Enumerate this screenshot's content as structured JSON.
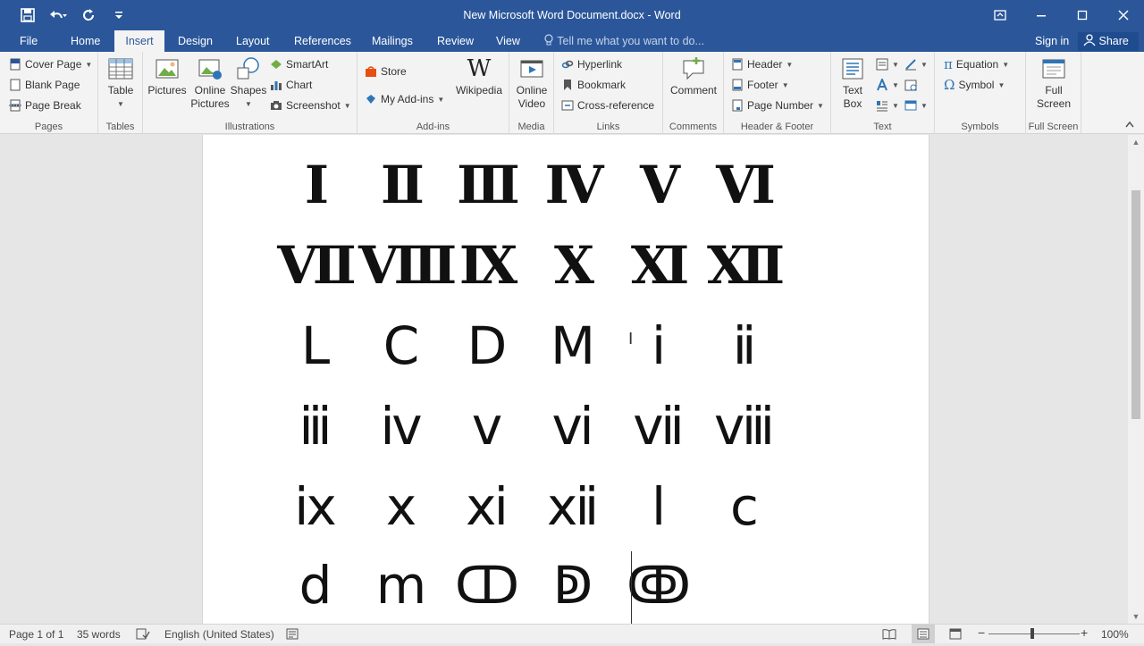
{
  "titlebar": {
    "title": "New Microsoft Word Document.docx - Word",
    "qat": {
      "save_icon": "save-icon",
      "undo_icon": "undo-icon",
      "redo_icon": "redo-icon",
      "customize_icon": "customize-icon"
    },
    "window": {
      "ribbon_options_icon": "ribbon-display-icon",
      "minimize_icon": "minimize-icon",
      "maximize_icon": "maximize-icon",
      "close_icon": "close-icon"
    }
  },
  "tabs": [
    {
      "label": "File"
    },
    {
      "label": "Home"
    },
    {
      "label": "Insert"
    },
    {
      "label": "Design"
    },
    {
      "label": "Layout"
    },
    {
      "label": "References"
    },
    {
      "label": "Mailings"
    },
    {
      "label": "Review"
    },
    {
      "label": "View"
    }
  ],
  "tell_me": "Tell me what you want to do...",
  "sign_in": "Sign in",
  "share": "Share",
  "ribbon": {
    "pages": {
      "label": "Pages",
      "cover_page": "Cover Page",
      "blank_page": "Blank Page",
      "page_break": "Page Break"
    },
    "tables": {
      "label": "Tables",
      "table": "Table"
    },
    "illustrations": {
      "label": "Illustrations",
      "pictures": "Pictures",
      "online_pictures_1": "Online",
      "online_pictures_2": "Pictures",
      "shapes": "Shapes",
      "smartart": "SmartArt",
      "chart": "Chart",
      "screenshot": "Screenshot"
    },
    "addins": {
      "label": "Add-ins",
      "store": "Store",
      "my_addins": "My Add-ins",
      "wikipedia": "Wikipedia"
    },
    "media": {
      "label": "Media",
      "online_video_1": "Online",
      "online_video_2": "Video"
    },
    "links": {
      "label": "Links",
      "hyperlink": "Hyperlink",
      "bookmark": "Bookmark",
      "cross_reference": "Cross-reference"
    },
    "comments": {
      "label": "Comments",
      "comment": "Comment"
    },
    "header_footer": {
      "label": "Header & Footer",
      "header": "Header",
      "footer": "Footer",
      "page_number": "Page Number"
    },
    "text": {
      "label": "Text",
      "text_box_1": "Text",
      "text_box_2": "Box"
    },
    "symbols": {
      "label": "Symbols",
      "equation": "Equation",
      "symbol": "Symbol"
    },
    "full_screen": {
      "label": "Full Screen",
      "full_1": "Full",
      "full_2": "Screen"
    }
  },
  "document": {
    "rows": [
      [
        "Ⅰ",
        "Ⅱ",
        "Ⅲ",
        "Ⅳ",
        "Ⅴ",
        "Ⅵ"
      ],
      [
        "Ⅶ",
        "Ⅷ",
        "Ⅸ",
        "Ⅹ",
        "Ⅺ",
        "Ⅻ"
      ],
      [
        "Ⅼ",
        "Ⅽ",
        "Ⅾ",
        "Ⅿ",
        "ⅰ",
        "ⅱ"
      ],
      [
        "ⅲ",
        "ⅳ",
        "ⅴ",
        "ⅵ",
        "ⅶ",
        "ⅷ"
      ],
      [
        "ⅸ",
        "ⅹ",
        "ⅺ",
        "ⅻ",
        "ⅼ",
        "ⅽ"
      ],
      [
        "ⅾ",
        "ⅿ",
        "ↀ",
        "ↁ",
        "ↂ"
      ]
    ]
  },
  "status": {
    "page": "Page 1 of 1",
    "words": "35 words",
    "language": "English (United States)",
    "zoom": "100%",
    "zoom_value": 100
  }
}
